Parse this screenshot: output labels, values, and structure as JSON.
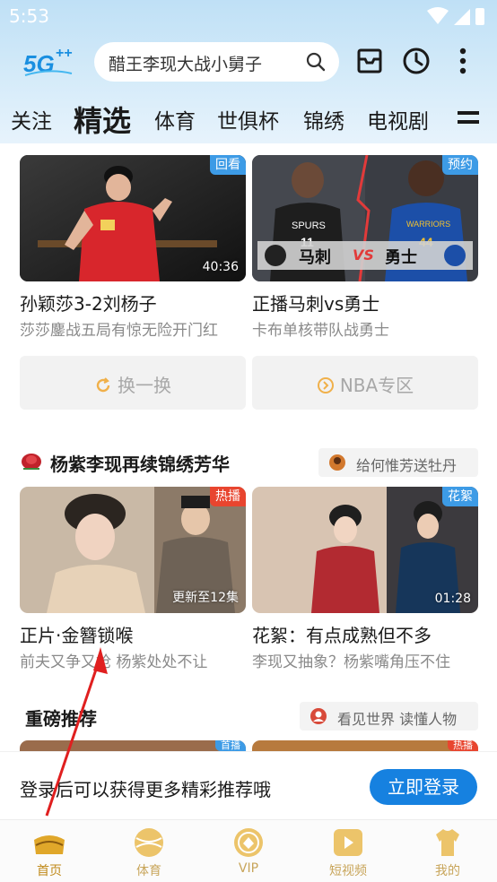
{
  "status": {
    "time": "5:53"
  },
  "header": {
    "logo_text": "5G",
    "search_placeholder": "醋王李现大战小舅子",
    "icons": [
      "search-icon",
      "inbox-icon",
      "history-clock-icon",
      "more-vertical-icon"
    ]
  },
  "tabs": [
    {
      "label": "关注"
    },
    {
      "label": "精选",
      "active": true
    },
    {
      "label": "体育"
    },
    {
      "label": "世俱杯"
    },
    {
      "label": "锦绣"
    },
    {
      "label": "电视剧"
    }
  ],
  "section1": {
    "cards": [
      {
        "badge": "回看",
        "duration": "40:36",
        "title": "孙颖莎3-2刘杨子",
        "subtitle": "莎莎鏖战五局有惊无险开门红"
      },
      {
        "badge": "预约",
        "title": "正播马刺vs勇士",
        "subtitle": "卡布单核带队战勇士",
        "poster": {
          "team_left": "马刺",
          "vs": "VS",
          "team_right": "勇士"
        }
      }
    ],
    "buttons": {
      "refresh": "换一换",
      "nba": "NBA专区"
    }
  },
  "section2": {
    "title": "杨紫李现再续锦绣芳华",
    "chip": "给何惟芳送牡丹",
    "cards": [
      {
        "badge": "热播",
        "update": "更新至12集",
        "title": "正片·金簪锁喉",
        "subtitle": "前夫又争又抢 杨紫处处不让"
      },
      {
        "badge": "花絮",
        "duration": "01:28",
        "title": "花絮：有点成熟但不多",
        "subtitle": "李现又抽象？杨紫嘴角压不住"
      }
    ]
  },
  "section3": {
    "title": "重磅推荐",
    "chip": "看见世界 读懂人物",
    "badges": [
      "首播",
      "热播"
    ]
  },
  "login_bar": {
    "text": "登录后可以获得更多精彩推荐哦",
    "button": "立即登录"
  },
  "bottom_nav": [
    {
      "label": "首页",
      "icon": "home-icon",
      "active": true
    },
    {
      "label": "体育",
      "icon": "sports-icon"
    },
    {
      "label": "VIP",
      "icon": "vip-icon"
    },
    {
      "label": "短视频",
      "icon": "short-video-icon"
    },
    {
      "label": "我的",
      "icon": "profile-icon"
    }
  ],
  "colors": {
    "accent": "#1681e0",
    "nav_gold": "#c8a55a",
    "badge_blue": "#3d9be6",
    "badge_red": "#e8452f"
  }
}
